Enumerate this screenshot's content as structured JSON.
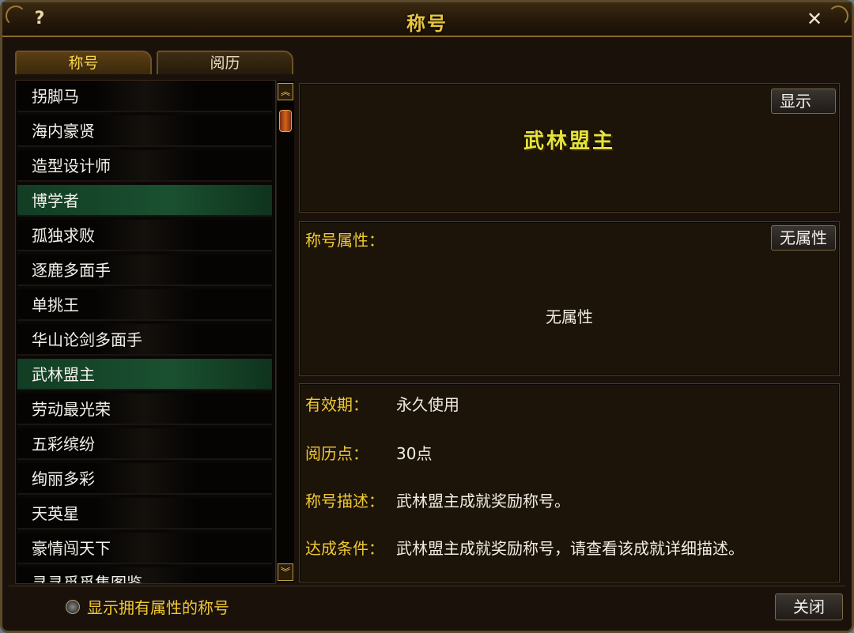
{
  "window": {
    "title": "称号",
    "help": "?",
    "close": "✕"
  },
  "tabs": [
    {
      "label": "称号"
    },
    {
      "label": "阅历"
    }
  ],
  "titles_list": [
    {
      "label": "拐脚马"
    },
    {
      "label": "海内豪贤"
    },
    {
      "label": "造型设计师"
    },
    {
      "label": "博学者",
      "highlight": true
    },
    {
      "label": "孤独求败"
    },
    {
      "label": "逐鹿多面手"
    },
    {
      "label": "单挑王"
    },
    {
      "label": "华山论剑多面手"
    },
    {
      "label": "武林盟主",
      "highlight": true
    },
    {
      "label": "劳动最光荣"
    },
    {
      "label": "五彩缤纷"
    },
    {
      "label": "绚丽多彩"
    },
    {
      "label": "天英星"
    },
    {
      "label": "豪情闯天下"
    },
    {
      "label": "寻寻觅觅集图鉴"
    }
  ],
  "detail": {
    "show_button": "显示",
    "title_name": "武林盟主",
    "attr_label": "称号属性：",
    "attr_button": "无属性",
    "attr_value": "无属性",
    "validity_label": "有效期：",
    "validity_value": "永久使用",
    "exp_label": "阅历点：",
    "exp_value": "30点",
    "desc_label": "称号描述：",
    "desc_value": "武林盟主成就奖励称号。",
    "cond_label": "达成条件：",
    "cond_value": "武林盟主成就奖励称号，请查看该成就详细描述。"
  },
  "footer": {
    "radio_label": "显示拥有属性的称号",
    "close_button": "关闭"
  },
  "colors": {
    "gold": "#f0c832",
    "title_yellow": "#e4e43c",
    "selected_row": "#1a5030"
  }
}
